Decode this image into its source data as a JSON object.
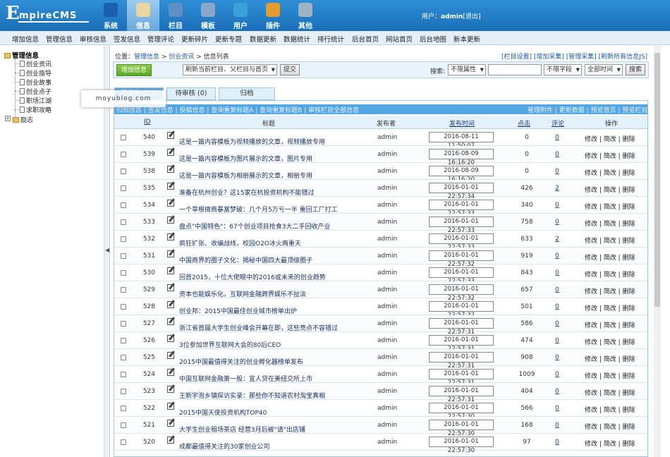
{
  "app": {
    "logo_first": "E",
    "logo_rest": "mpireCMS"
  },
  "nav": [
    {
      "label": "系统",
      "icon": "globe-icon",
      "color": "#1b5fb0"
    },
    {
      "label": "信息",
      "icon": "edit-doc-icon",
      "color": "#e8d6a0"
    },
    {
      "label": "栏目",
      "icon": "folder-icon",
      "color": "#5d8ec4"
    },
    {
      "label": "模板",
      "icon": "template-icon",
      "color": "#8aa6c8"
    },
    {
      "label": "用户",
      "icon": "user-icon",
      "color": "#3aa0d8"
    },
    {
      "label": "插件",
      "icon": "tools-icon",
      "color": "#e39b2f"
    },
    {
      "label": "其他",
      "icon": "gear-icon",
      "color": "#9fb3c6"
    }
  ],
  "user": {
    "prefix": "用户：",
    "name": "admin",
    "logout": "[退出]"
  },
  "menubar": [
    "增加信息",
    "管理信息",
    "审核信息",
    "签发信息",
    "管理评论",
    "更新碎片",
    "更新专题",
    "数据更新",
    "数据统计",
    "排行统计",
    "后台首页",
    "网站首页",
    "后台地图",
    "新本更新"
  ],
  "sidebar": {
    "root": "管理信息",
    "items": [
      "创业资讯",
      "创业指导",
      "创业故事",
      "创业点子",
      "职场江湖",
      "求职攻略"
    ],
    "collapsed": "励志"
  },
  "breadcrumb": {
    "prefix": "位置：",
    "a": "管理信息",
    "sep": " > ",
    "b": "创业资讯",
    "c": "信息列表"
  },
  "top_right": "[栏目设置] [增加采集] [管理采集] [刷新所有信息JS]",
  "toolbar": {
    "add": "增加信息",
    "refresh_select": "刷新当前栏目、父栏目与首页",
    "submit": "提交",
    "search_label": "搜索:",
    "attr_select": "不限属性",
    "search_value": "",
    "field_select": "不限字段",
    "time_select": "全部时间",
    "search_btn": "搜索"
  },
  "tabs": [
    {
      "label": "已发布 (23)",
      "active": true
    },
    {
      "label": "待审核 (0)",
      "active": false
    },
    {
      "label": "归档",
      "active": false
    }
  ],
  "subbar": {
    "left": "归档信息 | 签发信息 | 投稿信息 | 查询重复标题A | 查询重复标题B | 审核栏目全部信息",
    "right": "管理附件 | 更新数据 | 预览首页 | 预览栏目"
  },
  "table": {
    "headers": {
      "id": "ID",
      "title": "标题",
      "publisher": "发布者",
      "time": "发布时间",
      "clicks": "点击",
      "comments": "评论",
      "ops": "操作"
    },
    "op_text": "修改 | 简改 | 删除",
    "rows": [
      {
        "id": "540",
        "title": "这是一篇内容模板为视频播放的文章，视频播放专用",
        "pub": "admin",
        "time": "2016-08-11 11:50:07",
        "clicks": "0",
        "comments": "0"
      },
      {
        "id": "539",
        "title": "这是一篇内容模板为图片展示的文章，图片专用",
        "pub": "admin",
        "time": "2016-08-09 16:16:20",
        "clicks": "0",
        "comments": "0"
      },
      {
        "id": "538",
        "title": "这是一篇内容模板为相册展示的文章，相册专用",
        "pub": "admin",
        "time": "2016-08-09 16:16:20",
        "clicks": "0",
        "comments": "0"
      },
      {
        "id": "535",
        "title": "准备在杭州创业？这15家在杭投资机构不能错过",
        "pub": "admin",
        "time": "2016-01-01 22:57:34",
        "clicks": "426",
        "comments": "2"
      },
      {
        "id": "534",
        "title": "一个草根微商暴富梦破：几个月5万亏一半 重回工厂打工",
        "pub": "admin",
        "time": "2016-01-01 22:57:33",
        "clicks": "340",
        "comments": "0"
      },
      {
        "id": "533",
        "title": "盘点\"中国特色\"：67个创业项目抢食3大二手回收产业",
        "pub": "admin",
        "time": "2016-01-01 22:57:33",
        "clicks": "758",
        "comments": "0"
      },
      {
        "id": "532",
        "title": "疯狂扩张、收编战线，校园O2O冰火两重天",
        "pub": "admin",
        "time": "2016-01-01 22:57:33",
        "clicks": "633",
        "comments": "2"
      },
      {
        "id": "531",
        "title": "中国商界的圈子文化：揭秘中国四大最顶级圈子",
        "pub": "admin",
        "time": "2016-01-01 22:57:32",
        "clicks": "919",
        "comments": "0"
      },
      {
        "id": "530",
        "title": "回首2015，十位大佬眼中的2016或未来的创业趋势",
        "pub": "admin",
        "time": "2016-01-01 22:57:33",
        "clicks": "843",
        "comments": "0"
      },
      {
        "id": "529",
        "title": "资本也能娱乐化，互联网金融跨界娱乐不扯淡",
        "pub": "admin",
        "time": "2016-01-01 22:57:32",
        "clicks": "657",
        "comments": "0"
      },
      {
        "id": "528",
        "title": "创业邦：2015中国最佳创业城市榜单出炉",
        "pub": "admin",
        "time": "2016-01-01 22:57:32",
        "clicks": "501",
        "comments": "0"
      },
      {
        "id": "527",
        "title": "浙江省首届大学生创业峰会开幕在即，这些亮点不容错过",
        "pub": "admin",
        "time": "2016-01-01 22:57:31",
        "clicks": "586",
        "comments": "0"
      },
      {
        "id": "526",
        "title": "3位参加世界互联网大会的80后CEO",
        "pub": "admin",
        "time": "2016-01-01 22:57:31",
        "clicks": "474",
        "comments": "0"
      },
      {
        "id": "525",
        "title": "2015中国最值得关注的创业孵化器榜单发布",
        "pub": "admin",
        "time": "2016-01-01 22:57:31",
        "clicks": "908",
        "comments": "0"
      },
      {
        "id": "524",
        "title": "中国互联网金融第一股：宜人贷在美纽交所上市",
        "pub": "admin",
        "time": "2016-01-01 22:57:31",
        "clicks": "1009",
        "comments": "0"
      },
      {
        "id": "523",
        "title": "王新宇泡乡镇探访实录：那些你不知道农村淘宝真相",
        "pub": "admin",
        "time": "2016-01-01 22:57:31",
        "clicks": "404",
        "comments": "0"
      },
      {
        "id": "522",
        "title": "2015中国天使投资机构TOP40",
        "pub": "admin",
        "time": "2016-01-01 22:57:30",
        "clicks": "566",
        "comments": "0"
      },
      {
        "id": "521",
        "title": "大学生创业租场茶店 经营3月后被\"请\"出店铺",
        "pub": "admin",
        "time": "2016-01-01 22:57:30",
        "clicks": "168",
        "comments": "0"
      },
      {
        "id": "520",
        "title": "成都最值得关注的30家创业公司",
        "pub": "admin",
        "time": "2016-01-01 22:57:30",
        "clicks": "97",
        "comments": "0"
      }
    ]
  },
  "watermark": "moyublog.com"
}
